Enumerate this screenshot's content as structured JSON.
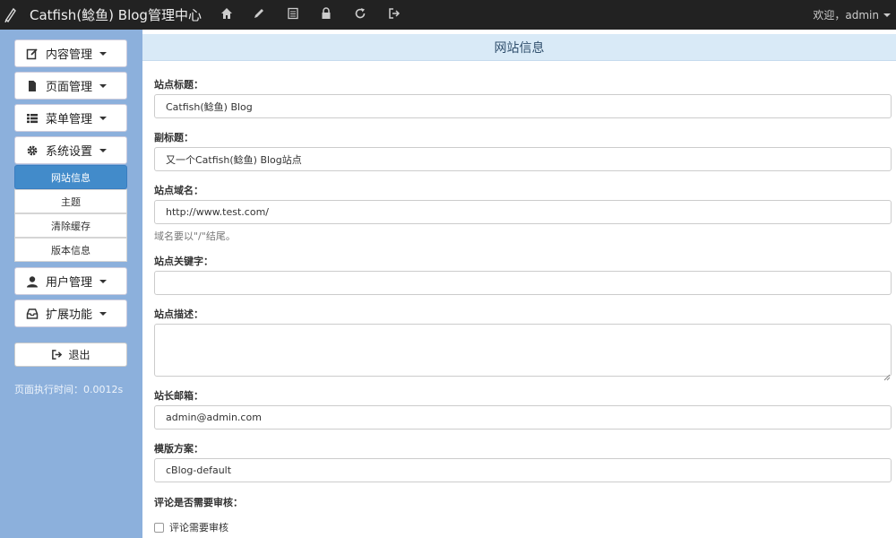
{
  "header": {
    "brand": "Catfish(鲶鱼) Blog管理中心",
    "user_label": "欢迎，admin",
    "nav_icons": [
      "home-icon",
      "pencil-icon",
      "list-alt-icon",
      "lock-icon",
      "refresh-icon",
      "log-out-icon"
    ]
  },
  "sidebar": {
    "menus": [
      {
        "label": "内容管理",
        "icon": "edit-icon"
      },
      {
        "label": "页面管理",
        "icon": "file-icon"
      },
      {
        "label": "菜单管理",
        "icon": "list-icon"
      },
      {
        "label": "系统设置",
        "icon": "cog-icon"
      },
      {
        "label": "用户管理",
        "icon": "user-icon"
      },
      {
        "label": "扩展功能",
        "icon": "inbox-icon"
      }
    ],
    "submenu": [
      "网站信息",
      "主题",
      "清除缓存",
      "版本信息"
    ],
    "active_submenu": "网站信息",
    "logout_label": "退出",
    "exec_time": "页面执行时间：0.0012s"
  },
  "main": {
    "title": "网站信息",
    "fields": {
      "site_title": {
        "label": "站点标题：",
        "value": "Catfish(鲶鱼) Blog"
      },
      "subtitle": {
        "label": "副标题：",
        "value": "又一个Catfish(鲶鱼) Blog站点"
      },
      "domain": {
        "label": "站点域名：",
        "value": "http://www.test.com/",
        "help": "域名要以\"/\"结尾。"
      },
      "keywords": {
        "label": "站点关键字：",
        "value": ""
      },
      "description": {
        "label": "站点描述：",
        "value": ""
      },
      "email": {
        "label": "站长邮箱：",
        "value": "admin@admin.com"
      },
      "template": {
        "label": "模版方案：",
        "value": "cBlog-default"
      },
      "review": {
        "label": "评论是否需要审核：",
        "checkbox_label": "评论需要审核",
        "checked": false
      }
    }
  },
  "colors": {
    "navbar_bg": "#222222",
    "sidebar_bg": "#8cb0dc",
    "active_item": "#428bca",
    "panel_heading_bg": "#d9eaf7"
  }
}
